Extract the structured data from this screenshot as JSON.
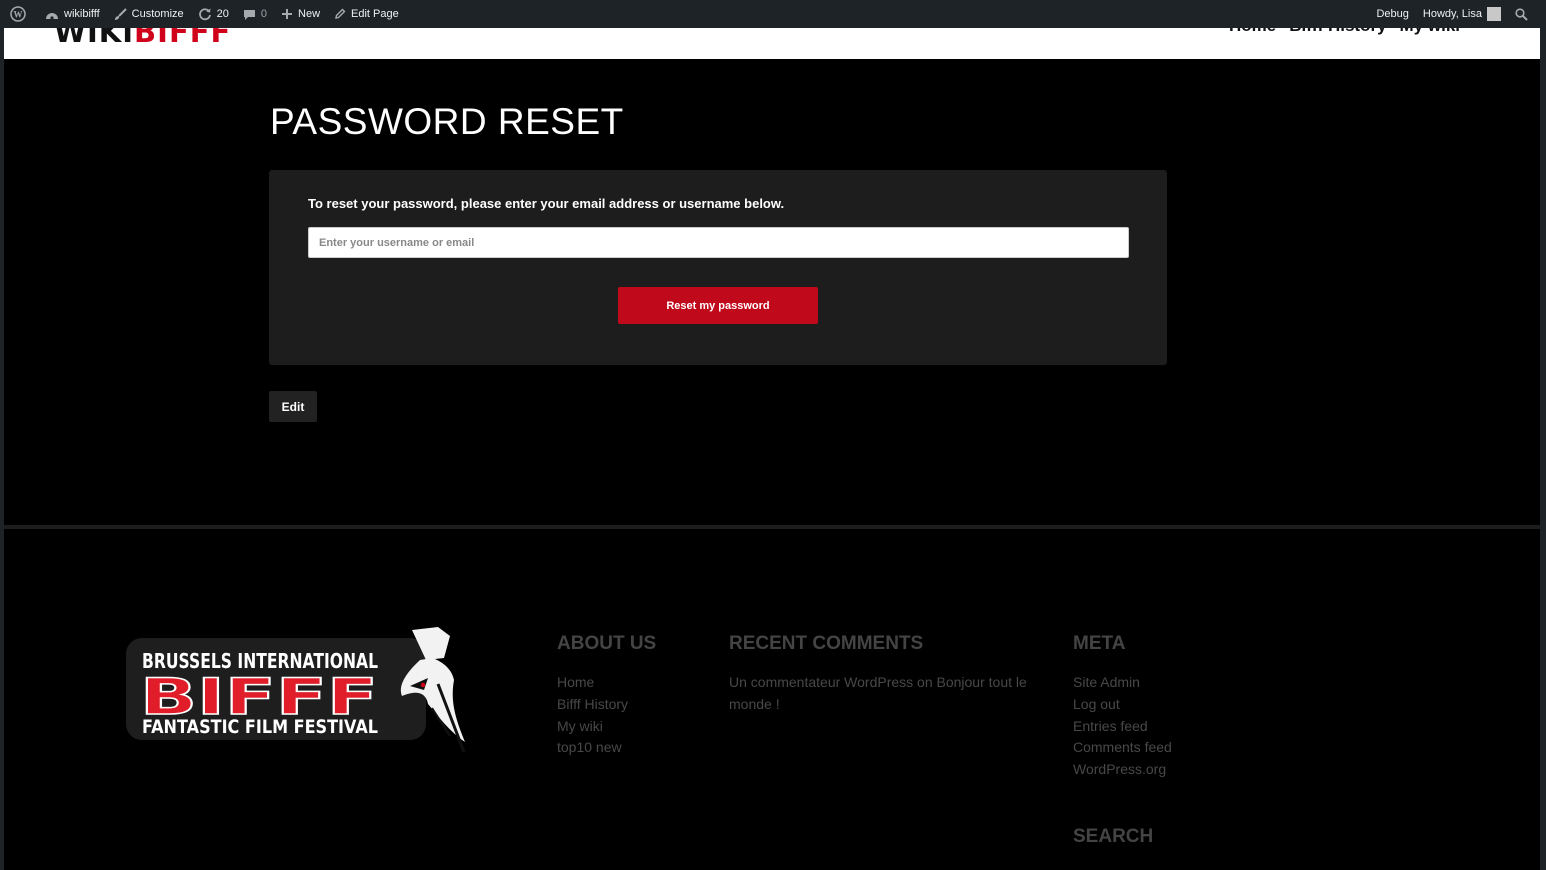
{
  "admin_bar": {
    "site_name": "wikibifff",
    "customize": "Customize",
    "updates_count": "20",
    "comments_count": "0",
    "new_label": "New",
    "edit_page": "Edit Page",
    "debug": "Debug",
    "howdy": "Howdy, Lisa"
  },
  "header": {
    "logo_wiki": "WIKI",
    "logo_biff": "BIFFF",
    "nav": [
      "Home",
      "Bifff History",
      "My wiki"
    ]
  },
  "page": {
    "title": "PASSWORD RESET",
    "instructions": "To reset your password, please enter your email address or username below.",
    "input_placeholder": "Enter your username or email",
    "reset_button": "Reset my password",
    "edit_button": "Edit"
  },
  "footer": {
    "logo": {
      "line1": "BRUSSELS INTERNATIONAL",
      "brand": "BIFFF",
      "line3": "FANTASTIC FILM FESTIVAL"
    },
    "about": {
      "title": "ABOUT US",
      "links": [
        "Home",
        "Bifff History",
        "My wiki",
        "top10 new"
      ]
    },
    "recent_comments": {
      "title": "RECENT COMMENTS",
      "author": "Un commentateur WordPress",
      "on": "on",
      "post": "Bonjour tout le monde !"
    },
    "meta": {
      "title": "META",
      "links": [
        "Site Admin",
        "Log out",
        "Entries feed",
        "Comments feed",
        "WordPress.org"
      ]
    },
    "search_title": "SEARCH"
  },
  "colors": {
    "accent_red": "#c0091a",
    "admin_bar_bg": "#1d2327",
    "card_bg": "#1d1d1d"
  }
}
